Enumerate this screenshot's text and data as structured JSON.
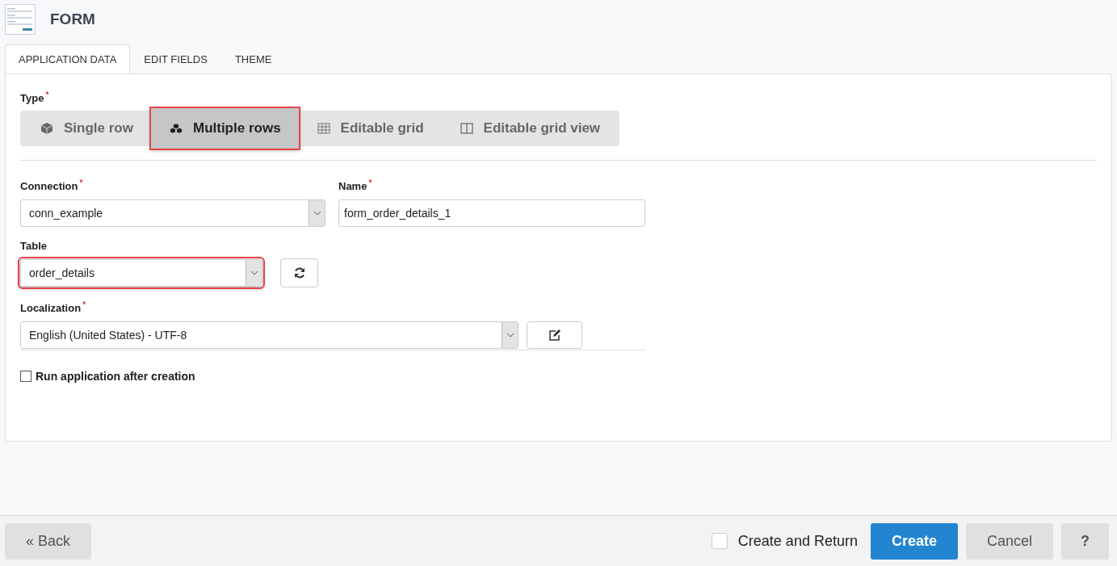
{
  "header": {
    "title": "FORM"
  },
  "tabs": [
    {
      "label": "APPLICATION DATA",
      "selected": true
    },
    {
      "label": "EDIT FIELDS",
      "selected": false
    },
    {
      "label": "THEME",
      "selected": false
    }
  ],
  "type_field": {
    "label": "Type",
    "required_mark": "*",
    "options": [
      {
        "label": "Single row",
        "kind": "cube",
        "selected": false,
        "highlighted": false
      },
      {
        "label": "Multiple rows",
        "kind": "cubes",
        "selected": true,
        "highlighted": true
      },
      {
        "label": "Editable grid",
        "kind": "grid",
        "selected": false,
        "highlighted": false
      },
      {
        "label": "Editable grid view",
        "kind": "columns",
        "selected": false,
        "highlighted": false
      }
    ]
  },
  "connection": {
    "label": "Connection",
    "required_mark": "*",
    "value": "conn_example"
  },
  "name": {
    "label": "Name",
    "required_mark": "*",
    "value": "form_order_details_1"
  },
  "table": {
    "label": "Table",
    "value": "order_details",
    "highlighted": true
  },
  "localization": {
    "label": "Localization",
    "required_mark": "*",
    "value": "English (United States) - UTF-8"
  },
  "run_after": {
    "label": "Run application after creation",
    "checked": false
  },
  "footer": {
    "back": "« Back",
    "create_and_return": {
      "label": "Create and Return",
      "checked": false
    },
    "create": "Create",
    "cancel": "Cancel",
    "help": "?"
  }
}
